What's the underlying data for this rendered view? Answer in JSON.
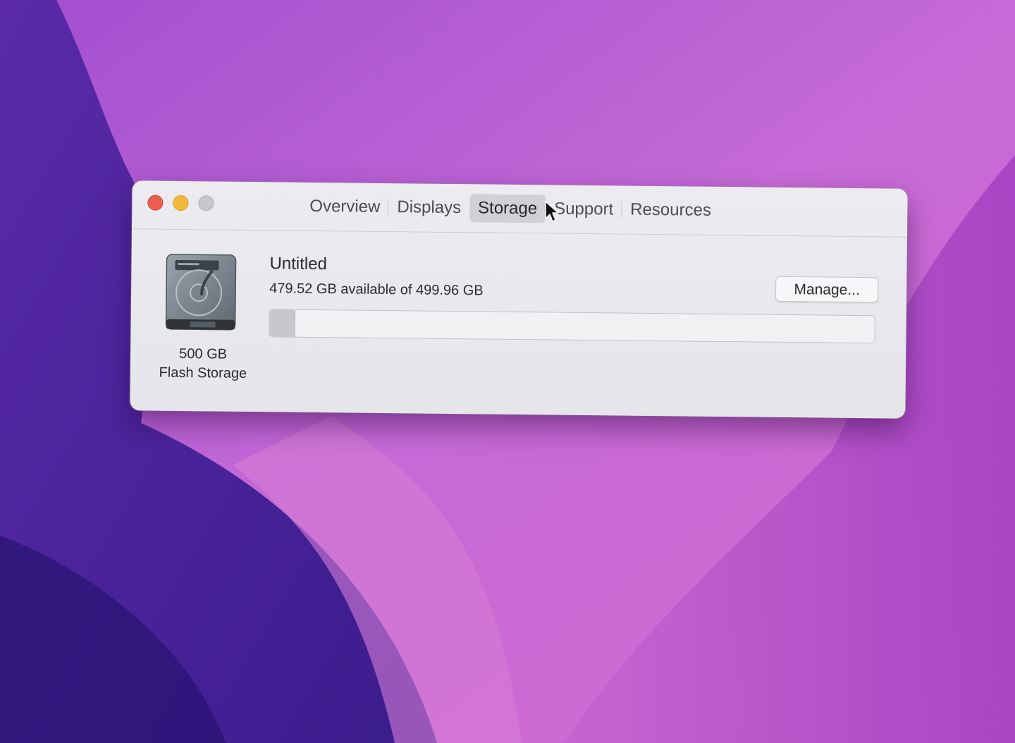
{
  "window": {
    "controls": [
      "close",
      "minimize",
      "zoom"
    ],
    "tabs": [
      {
        "label": "Overview",
        "active": false
      },
      {
        "label": "Displays",
        "active": false
      },
      {
        "label": "Storage",
        "active": true
      },
      {
        "label": "Support",
        "active": false
      },
      {
        "label": "Resources",
        "active": false
      }
    ]
  },
  "storage": {
    "drive_icon": "hard-drive-icon",
    "drive_capacity": "500 GB",
    "drive_type": "Flash Storage",
    "volume_name": "Untitled",
    "availability": "479.52 GB available of 499.96 GB",
    "used_fraction": 0.041,
    "manage_label": "Manage..."
  },
  "colors": {
    "close": "#ec5e52",
    "minimize": "#f2b83a",
    "zoom": "#c8c6cb"
  }
}
